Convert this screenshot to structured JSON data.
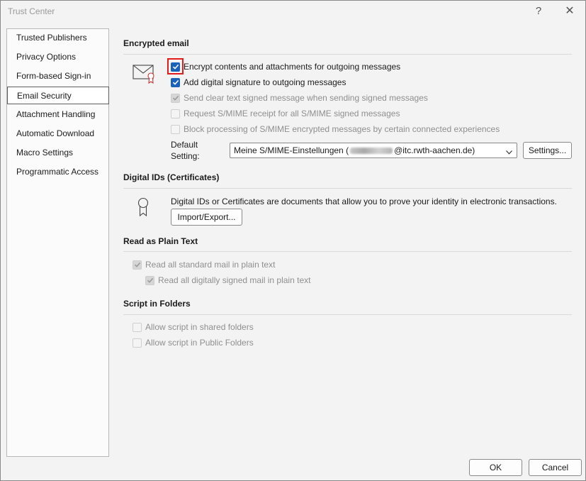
{
  "window": {
    "title": "Trust Center",
    "help_label": "?",
    "close_label": "✕"
  },
  "sidebar": {
    "items": [
      {
        "label": "Trusted Publishers"
      },
      {
        "label": "Privacy Options"
      },
      {
        "label": "Form-based Sign-in"
      },
      {
        "label": "Email Security",
        "selected": true
      },
      {
        "label": "Attachment Handling"
      },
      {
        "label": "Automatic Download"
      },
      {
        "label": "Macro Settings"
      },
      {
        "label": "Programmatic Access"
      }
    ]
  },
  "encrypted_email": {
    "title": "Encrypted email",
    "encrypt_contents": {
      "label": "Encrypt contents and attachments for outgoing messages",
      "checked": true
    },
    "add_signature": {
      "label": "Add digital signature to outgoing messages",
      "checked": true
    },
    "send_clear_text": {
      "label": "Send clear text signed message when sending signed messages",
      "checked": true,
      "disabled": true
    },
    "request_receipt": {
      "label": "Request S/MIME receipt for all S/MIME signed messages",
      "checked": false,
      "disabled": true
    },
    "block_processing": {
      "label": "Block processing of S/MIME encrypted messages by certain connected experiences",
      "checked": false,
      "disabled": true
    },
    "default_setting_label_1": "Default",
    "default_setting_label_2": "Setting:",
    "default_setting_value_prefix": "Meine S/MIME-Einstellungen (",
    "default_setting_value_suffix": "@itc.rwth-aachen.de)",
    "settings_button": "Settings..."
  },
  "digital_ids": {
    "title": "Digital IDs (Certificates)",
    "description": "Digital IDs or Certificates are documents that allow you to prove your identity in electronic transactions.",
    "import_export_button": "Import/Export..."
  },
  "plain_text": {
    "title": "Read as Plain Text",
    "read_all": {
      "label": "Read all standard mail in plain text",
      "checked": true,
      "disabled": true
    },
    "read_signed": {
      "label": "Read all digitally signed mail in plain text",
      "checked": true,
      "disabled": true
    }
  },
  "script_folders": {
    "title": "Script in Folders",
    "shared": {
      "label": "Allow script in shared folders",
      "checked": false,
      "disabled": true
    },
    "public": {
      "label": "Allow script in Public Folders",
      "checked": false,
      "disabled": true
    }
  },
  "footer": {
    "ok": "OK",
    "cancel": "Cancel"
  },
  "colors": {
    "accent": "#1b62b9",
    "focus_highlight": "#e31b1b"
  }
}
